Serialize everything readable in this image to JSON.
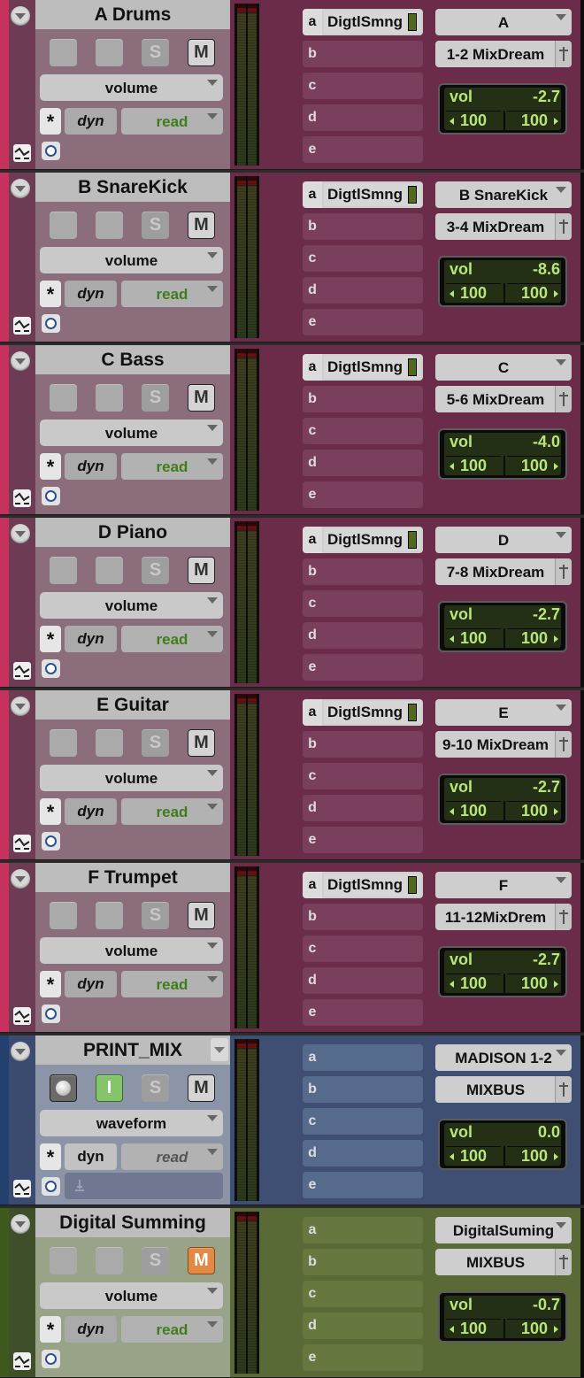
{
  "colors": {
    "audio": {
      "bar": "#c6315e",
      "gutter": "#6e3b55",
      "strip": "#8c6d7b",
      "panel": "#6b2c4a",
      "slot": "#7a3f5c"
    },
    "master": {
      "bar": "#23406f",
      "gutter": "#3b4b70",
      "strip": "#8c95a8",
      "panel": "#3e4f73",
      "slot": "#566b8c"
    },
    "aux": {
      "bar": "#3e5a1e",
      "gutter": "#3f4f29",
      "strip": "#98a388",
      "panel": "#5a6a37",
      "slot": "#66783f"
    }
  },
  "labels": {
    "solo": "S",
    "mute": "M",
    "input": "I",
    "auto_enable": "*",
    "vol": "vol",
    "insert_letters": [
      "a",
      "b",
      "c",
      "d",
      "e"
    ]
  },
  "tracks": [
    {
      "name": "A Drums",
      "kind": "audio",
      "view": "volume",
      "dyn": "dyn",
      "mode": "read",
      "plugin": "DigtlSmng",
      "output": "A",
      "bus": "1-2 MixDream",
      "vol": "-2.7",
      "pan_l": "100",
      "pan_r": "100"
    },
    {
      "name": "B SnareKick",
      "kind": "audio",
      "view": "volume",
      "dyn": "dyn",
      "mode": "read",
      "plugin": "DigtlSmng",
      "output": "B SnareKick",
      "bus": "3-4 MixDream",
      "vol": "-8.6",
      "pan_l": "100",
      "pan_r": "100"
    },
    {
      "name": "C Bass",
      "kind": "audio",
      "view": "volume",
      "dyn": "dyn",
      "mode": "read",
      "plugin": "DigtlSmng",
      "output": "C",
      "bus": "5-6 MixDream",
      "vol": "-4.0",
      "pan_l": "100",
      "pan_r": "100"
    },
    {
      "name": "D Piano",
      "kind": "audio",
      "view": "volume",
      "dyn": "dyn",
      "mode": "read",
      "plugin": "DigtlSmng",
      "output": "D",
      "bus": "7-8 MixDream",
      "vol": "-2.7",
      "pan_l": "100",
      "pan_r": "100"
    },
    {
      "name": "E Guitar",
      "kind": "audio",
      "view": "volume",
      "dyn": "dyn",
      "mode": "read",
      "plugin": "DigtlSmng",
      "output": "E",
      "bus": "9-10 MixDream",
      "vol": "-2.7",
      "pan_l": "100",
      "pan_r": "100"
    },
    {
      "name": "F Trumpet",
      "kind": "audio",
      "view": "volume",
      "dyn": "dyn",
      "mode": "read",
      "plugin": "DigtlSmng",
      "output": "F",
      "bus": "11-12MixDrem",
      "vol": "-2.7",
      "pan_l": "100",
      "pan_r": "100"
    },
    {
      "name": "PRINT_MIX",
      "kind": "master",
      "view": "waveform",
      "dyn": "dyn",
      "mode": "read",
      "plugin": "",
      "output": "MADISON 1-2",
      "bus": "MIXBUS",
      "vol": "0.0",
      "pan_l": "100",
      "pan_r": "100"
    },
    {
      "name": "Digital Summing",
      "kind": "aux",
      "view": "volume",
      "dyn": "dyn",
      "mode": "read",
      "plugin": "",
      "output": "DigitalSuming",
      "bus": "MIXBUS",
      "vol": "-0.7",
      "pan_l": "100",
      "pan_r": "100"
    }
  ]
}
